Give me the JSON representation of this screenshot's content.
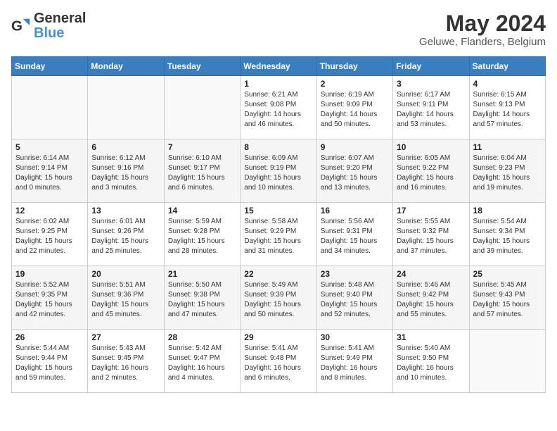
{
  "header": {
    "logo_general": "General",
    "logo_blue": "Blue",
    "month": "May 2024",
    "location": "Geluwe, Flanders, Belgium"
  },
  "weekdays": [
    "Sunday",
    "Monday",
    "Tuesday",
    "Wednesday",
    "Thursday",
    "Friday",
    "Saturday"
  ],
  "weeks": [
    [
      {
        "day": "",
        "sunrise": "",
        "sunset": "",
        "daylight": ""
      },
      {
        "day": "",
        "sunrise": "",
        "sunset": "",
        "daylight": ""
      },
      {
        "day": "",
        "sunrise": "",
        "sunset": "",
        "daylight": ""
      },
      {
        "day": "1",
        "sunrise": "Sunrise: 6:21 AM",
        "sunset": "Sunset: 9:08 PM",
        "daylight": "Daylight: 14 hours and 46 minutes."
      },
      {
        "day": "2",
        "sunrise": "Sunrise: 6:19 AM",
        "sunset": "Sunset: 9:09 PM",
        "daylight": "Daylight: 14 hours and 50 minutes."
      },
      {
        "day": "3",
        "sunrise": "Sunrise: 6:17 AM",
        "sunset": "Sunset: 9:11 PM",
        "daylight": "Daylight: 14 hours and 53 minutes."
      },
      {
        "day": "4",
        "sunrise": "Sunrise: 6:15 AM",
        "sunset": "Sunset: 9:13 PM",
        "daylight": "Daylight: 14 hours and 57 minutes."
      }
    ],
    [
      {
        "day": "5",
        "sunrise": "Sunrise: 6:14 AM",
        "sunset": "Sunset: 9:14 PM",
        "daylight": "Daylight: 15 hours and 0 minutes."
      },
      {
        "day": "6",
        "sunrise": "Sunrise: 6:12 AM",
        "sunset": "Sunset: 9:16 PM",
        "daylight": "Daylight: 15 hours and 3 minutes."
      },
      {
        "day": "7",
        "sunrise": "Sunrise: 6:10 AM",
        "sunset": "Sunset: 9:17 PM",
        "daylight": "Daylight: 15 hours and 6 minutes."
      },
      {
        "day": "8",
        "sunrise": "Sunrise: 6:09 AM",
        "sunset": "Sunset: 9:19 PM",
        "daylight": "Daylight: 15 hours and 10 minutes."
      },
      {
        "day": "9",
        "sunrise": "Sunrise: 6:07 AM",
        "sunset": "Sunset: 9:20 PM",
        "daylight": "Daylight: 15 hours and 13 minutes."
      },
      {
        "day": "10",
        "sunrise": "Sunrise: 6:05 AM",
        "sunset": "Sunset: 9:22 PM",
        "daylight": "Daylight: 15 hours and 16 minutes."
      },
      {
        "day": "11",
        "sunrise": "Sunrise: 6:04 AM",
        "sunset": "Sunset: 9:23 PM",
        "daylight": "Daylight: 15 hours and 19 minutes."
      }
    ],
    [
      {
        "day": "12",
        "sunrise": "Sunrise: 6:02 AM",
        "sunset": "Sunset: 9:25 PM",
        "daylight": "Daylight: 15 hours and 22 minutes."
      },
      {
        "day": "13",
        "sunrise": "Sunrise: 6:01 AM",
        "sunset": "Sunset: 9:26 PM",
        "daylight": "Daylight: 15 hours and 25 minutes."
      },
      {
        "day": "14",
        "sunrise": "Sunrise: 5:59 AM",
        "sunset": "Sunset: 9:28 PM",
        "daylight": "Daylight: 15 hours and 28 minutes."
      },
      {
        "day": "15",
        "sunrise": "Sunrise: 5:58 AM",
        "sunset": "Sunset: 9:29 PM",
        "daylight": "Daylight: 15 hours and 31 minutes."
      },
      {
        "day": "16",
        "sunrise": "Sunrise: 5:56 AM",
        "sunset": "Sunset: 9:31 PM",
        "daylight": "Daylight: 15 hours and 34 minutes."
      },
      {
        "day": "17",
        "sunrise": "Sunrise: 5:55 AM",
        "sunset": "Sunset: 9:32 PM",
        "daylight": "Daylight: 15 hours and 37 minutes."
      },
      {
        "day": "18",
        "sunrise": "Sunrise: 5:54 AM",
        "sunset": "Sunset: 9:34 PM",
        "daylight": "Daylight: 15 hours and 39 minutes."
      }
    ],
    [
      {
        "day": "19",
        "sunrise": "Sunrise: 5:52 AM",
        "sunset": "Sunset: 9:35 PM",
        "daylight": "Daylight: 15 hours and 42 minutes."
      },
      {
        "day": "20",
        "sunrise": "Sunrise: 5:51 AM",
        "sunset": "Sunset: 9:36 PM",
        "daylight": "Daylight: 15 hours and 45 minutes."
      },
      {
        "day": "21",
        "sunrise": "Sunrise: 5:50 AM",
        "sunset": "Sunset: 9:38 PM",
        "daylight": "Daylight: 15 hours and 47 minutes."
      },
      {
        "day": "22",
        "sunrise": "Sunrise: 5:49 AM",
        "sunset": "Sunset: 9:39 PM",
        "daylight": "Daylight: 15 hours and 50 minutes."
      },
      {
        "day": "23",
        "sunrise": "Sunrise: 5:48 AM",
        "sunset": "Sunset: 9:40 PM",
        "daylight": "Daylight: 15 hours and 52 minutes."
      },
      {
        "day": "24",
        "sunrise": "Sunrise: 5:46 AM",
        "sunset": "Sunset: 9:42 PM",
        "daylight": "Daylight: 15 hours and 55 minutes."
      },
      {
        "day": "25",
        "sunrise": "Sunrise: 5:45 AM",
        "sunset": "Sunset: 9:43 PM",
        "daylight": "Daylight: 15 hours and 57 minutes."
      }
    ],
    [
      {
        "day": "26",
        "sunrise": "Sunrise: 5:44 AM",
        "sunset": "Sunset: 9:44 PM",
        "daylight": "Daylight: 15 hours and 59 minutes."
      },
      {
        "day": "27",
        "sunrise": "Sunrise: 5:43 AM",
        "sunset": "Sunset: 9:45 PM",
        "daylight": "Daylight: 16 hours and 2 minutes."
      },
      {
        "day": "28",
        "sunrise": "Sunrise: 5:42 AM",
        "sunset": "Sunset: 9:47 PM",
        "daylight": "Daylight: 16 hours and 4 minutes."
      },
      {
        "day": "29",
        "sunrise": "Sunrise: 5:41 AM",
        "sunset": "Sunset: 9:48 PM",
        "daylight": "Daylight: 16 hours and 6 minutes."
      },
      {
        "day": "30",
        "sunrise": "Sunrise: 5:41 AM",
        "sunset": "Sunset: 9:49 PM",
        "daylight": "Daylight: 16 hours and 8 minutes."
      },
      {
        "day": "31",
        "sunrise": "Sunrise: 5:40 AM",
        "sunset": "Sunset: 9:50 PM",
        "daylight": "Daylight: 16 hours and 10 minutes."
      },
      {
        "day": "",
        "sunrise": "",
        "sunset": "",
        "daylight": ""
      }
    ]
  ]
}
